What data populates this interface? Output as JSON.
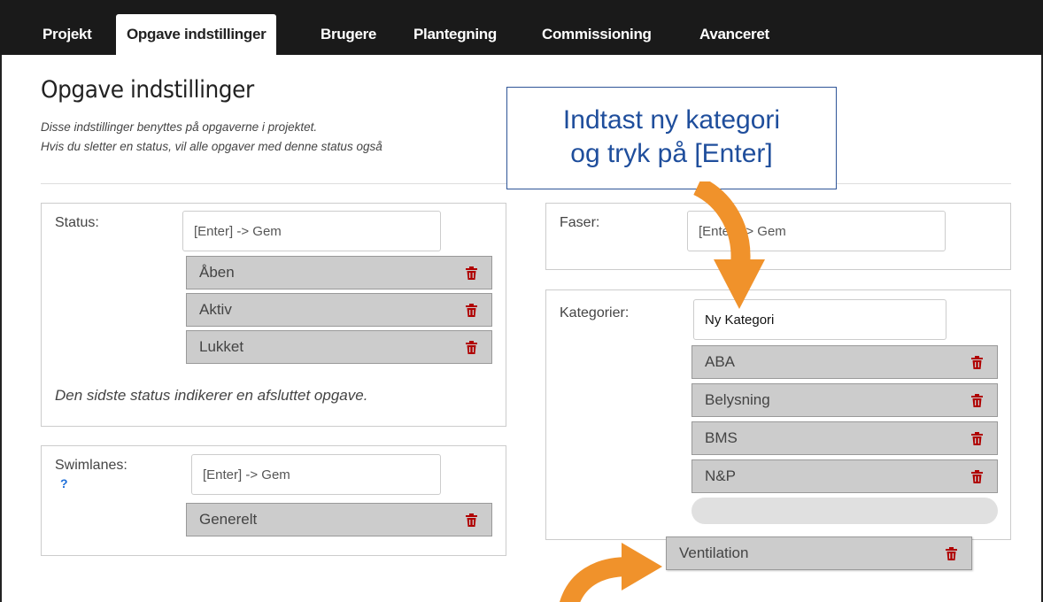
{
  "nav": {
    "tabs": [
      {
        "label": "Projekt"
      },
      {
        "label": "Opgave indstillinger"
      },
      {
        "label": "Brugere"
      },
      {
        "label": "Plantegning"
      },
      {
        "label": "Commissioning"
      },
      {
        "label": "Avanceret"
      }
    ],
    "active_tab": "Opgave indstillinger"
  },
  "page": {
    "title": "Opgave indstillinger",
    "desc_line1": "Disse indstillinger benyttes på opgaverne i projektet.",
    "desc_line2": "Hvis du sletter en status, vil alle opgaver med denne status også"
  },
  "status": {
    "label": "Status:",
    "placeholder": "[Enter] -> Gem",
    "items": [
      "Åben",
      "Aktiv",
      "Lukket"
    ],
    "note": "Den sidste status indikerer en afsluttet opgave."
  },
  "swimlanes": {
    "label": "Swimlanes:",
    "help": "?",
    "placeholder": "[Enter] -> Gem",
    "items": [
      "Generelt"
    ]
  },
  "faser": {
    "label": "Faser:",
    "placeholder": "[Enter] -> Gem"
  },
  "kategorier": {
    "label": "Kategorier:",
    "input_value": "Ny Kategori",
    "items": [
      "ABA",
      "Belysning",
      "BMS",
      "N&P"
    ],
    "dragged_item": "Ventilation"
  },
  "callout": {
    "line1": "Indtast ny kategori",
    "line2": "og tryk på [Enter]"
  },
  "icons": {
    "delete": "trash-icon",
    "arrow": "arrow-icon"
  },
  "colors": {
    "nav_bg": "#1a1a1a",
    "trash": "#b00000",
    "item_bg": "#cccccc",
    "callout_text": "#1f4e9c",
    "arrow": "#f0922b",
    "help": "#1e6fd9"
  }
}
